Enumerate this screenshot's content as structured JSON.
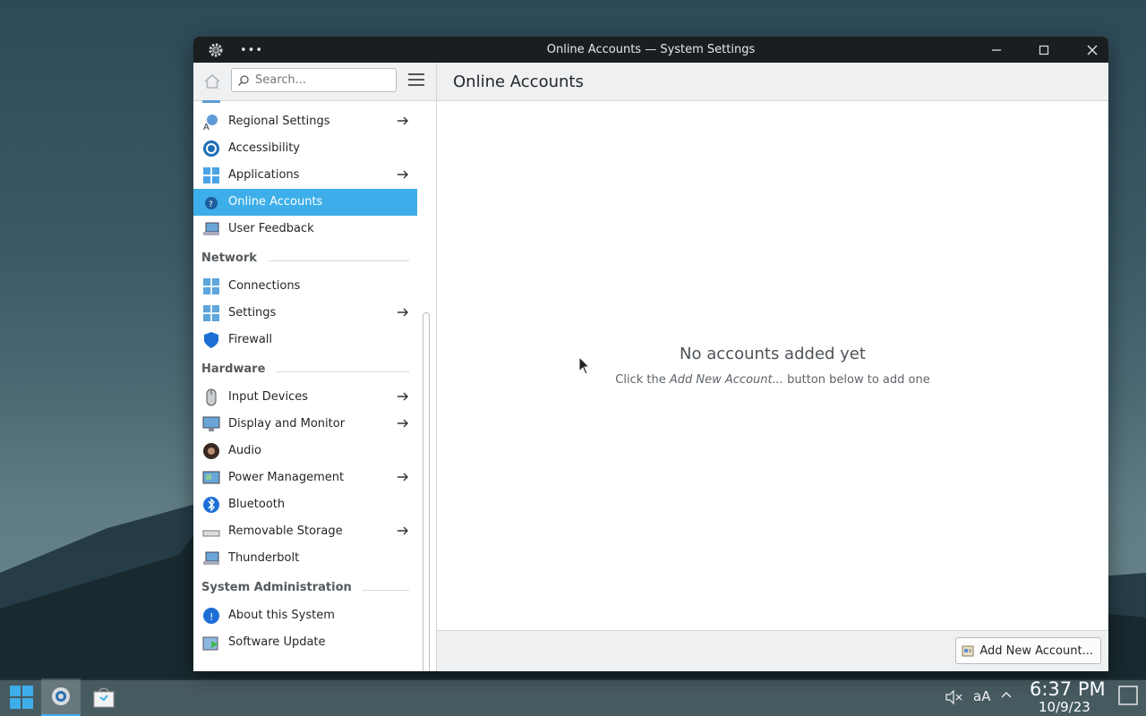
{
  "window": {
    "title": "Online Accounts — System Settings",
    "more_label": "•••"
  },
  "sidebar": {
    "search_placeholder": "Search...",
    "items_top": [
      {
        "label": "Regional Settings",
        "icon": "regional-settings-icon",
        "has_arrow": true
      },
      {
        "label": "Accessibility",
        "icon": "accessibility-icon",
        "has_arrow": false
      },
      {
        "label": "Applications",
        "icon": "applications-icon",
        "has_arrow": true
      },
      {
        "label": "Online Accounts",
        "icon": "online-accounts-icon",
        "has_arrow": false,
        "selected": true
      },
      {
        "label": "User Feedback",
        "icon": "user-feedback-icon",
        "has_arrow": false
      }
    ],
    "sections": [
      {
        "title": "Network",
        "items": [
          {
            "label": "Connections",
            "icon": "connections-icon",
            "has_arrow": false
          },
          {
            "label": "Settings",
            "icon": "network-settings-icon",
            "has_arrow": true
          },
          {
            "label": "Firewall",
            "icon": "firewall-icon",
            "has_arrow": false
          }
        ]
      },
      {
        "title": "Hardware",
        "items": [
          {
            "label": "Input Devices",
            "icon": "mouse-icon",
            "has_arrow": true
          },
          {
            "label": "Display and Monitor",
            "icon": "monitor-icon",
            "has_arrow": true
          },
          {
            "label": "Audio",
            "icon": "speaker-icon",
            "has_arrow": false
          },
          {
            "label": "Power Management",
            "icon": "power-icon",
            "has_arrow": true
          },
          {
            "label": "Bluetooth",
            "icon": "bluetooth-icon",
            "has_arrow": false
          },
          {
            "label": "Removable Storage",
            "icon": "removable-storage-icon",
            "has_arrow": true
          },
          {
            "label": "Thunderbolt",
            "icon": "thunderbolt-icon",
            "has_arrow": false
          }
        ]
      },
      {
        "title": "System Administration",
        "items": [
          {
            "label": "About this System",
            "icon": "info-icon",
            "has_arrow": false
          },
          {
            "label": "Software Update",
            "icon": "software-update-icon",
            "has_arrow": false
          }
        ]
      }
    ]
  },
  "main": {
    "title": "Online Accounts",
    "empty_title": "No accounts added yet",
    "empty_sub_prefix": "Click the ",
    "empty_sub_emph": "Add New Account...",
    "empty_sub_suffix": " button below to add one",
    "add_button_label": "Add New Account..."
  },
  "taskbar": {
    "time": "6:37 PM",
    "date": "10/9/23",
    "font_label": "aA"
  },
  "colors": {
    "accent": "#3daee9",
    "titlebar": "#1b1e20"
  }
}
